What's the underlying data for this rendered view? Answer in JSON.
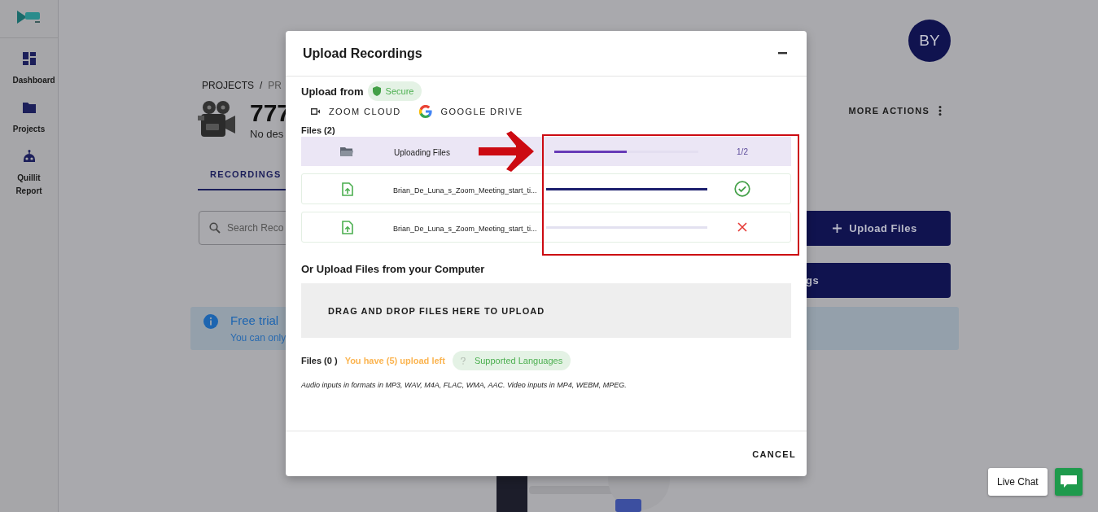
{
  "sidebar": {
    "items": [
      {
        "label": "Dashboard",
        "kind": "dashboard",
        "selected": false
      },
      {
        "label": "Projects",
        "kind": "folder",
        "selected": false
      },
      {
        "label": "Quillit Report",
        "kind": "robot",
        "selected": false
      }
    ]
  },
  "user": {
    "initials": "BY"
  },
  "breadcrumb": {
    "items": [
      "PROJECTS",
      "PR"
    ],
    "separator": "/"
  },
  "project": {
    "title": "777",
    "description": "No des"
  },
  "more_actions": "MORE ACTIONS",
  "tabs": [
    {
      "label": "RECORDINGS",
      "selected": true
    }
  ],
  "search": {
    "placeholder": "Search Reco"
  },
  "buttons": [
    {
      "label": "Upload Files",
      "kind": "upload"
    },
    {
      "label": "gs",
      "kind": "plain"
    }
  ],
  "banner": {
    "title": "Free trial",
    "text": "You can only"
  },
  "dialog": {
    "title": "Upload Recordings",
    "upload_from": "Upload from",
    "secure_badge": "Secure",
    "sources": [
      {
        "label": "ZOOM CLOUD",
        "kind": "zoom"
      },
      {
        "label": "GOOGLE DRIVE",
        "kind": "google"
      }
    ],
    "files_heading": "Files (2)",
    "summary": {
      "label": "Uploading Files",
      "level": 0.5,
      "count": "1/2"
    },
    "files": [
      {
        "name": "Brian_De_Luna_s_Zoom_Meeting_start_ti...",
        "level": 1,
        "done": true
      },
      {
        "name": "Brian_De_Luna_s_Zoom_Meeting_start_ti...",
        "level": 0,
        "done": false
      }
    ],
    "computer_heading": "Or Upload Files from your Computer",
    "drop_zone": "DRAG AND DROP FILES HERE TO UPLOAD",
    "files_count": "Files (0 )",
    "uploads_left": "You have (5) upload left",
    "languages_chip": "Supported Languages",
    "note": "Audio inputs in formats in MP3, WAV, M4A, FLAC, WMA, AAC. Video inputs in MP4, WEBM, MPEG.",
    "cancel": "CANCEL"
  },
  "live_chat": {
    "label": "Live Chat"
  }
}
